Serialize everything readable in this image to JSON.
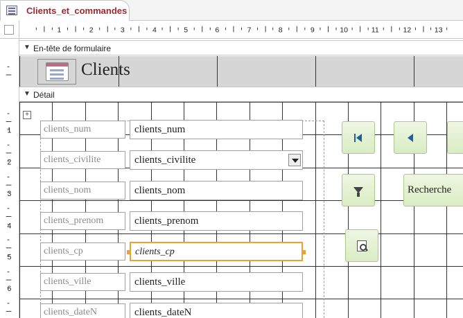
{
  "tab": {
    "title": "Clients_et_commandes",
    "icon": "form-icon"
  },
  "ruler": {
    "h_numbers": [
      "1",
      "2",
      "3",
      "4",
      "5",
      "6",
      "7",
      "8",
      "9",
      "10",
      "11",
      "12",
      "13"
    ],
    "v_numbers": [
      "1",
      "2",
      "3",
      "4",
      "5",
      "6"
    ]
  },
  "sections": {
    "header": {
      "label": "En-tête de formulaire",
      "title": "Clients"
    },
    "detail": {
      "label": "Détail"
    }
  },
  "fields": [
    {
      "label": "clients_num",
      "control": "clients_num"
    },
    {
      "label": "clients_civilite",
      "control": "clients_civilite"
    },
    {
      "label": "clients_nom",
      "control": "clients_nom"
    },
    {
      "label": "clients_prenom",
      "control": "clients_prenom"
    },
    {
      "label": "clients_cp",
      "control": "clients_cp"
    },
    {
      "label": "clients_ville",
      "control": "clients_ville"
    },
    {
      "label": "clients_dateN",
      "control": "clients_dateN"
    }
  ],
  "buttons": {
    "search_label": "Recherche",
    "icons": [
      "first-record-icon",
      "previous-record-icon",
      "filter-icon",
      "print-preview-icon"
    ]
  },
  "colors": {
    "tab_title": "#a4262c",
    "header_background": "#d6d6d6",
    "selection": "#f0a030",
    "button_green": "#d9ecc3",
    "nav_icon_blue": "#1f5f9e"
  }
}
